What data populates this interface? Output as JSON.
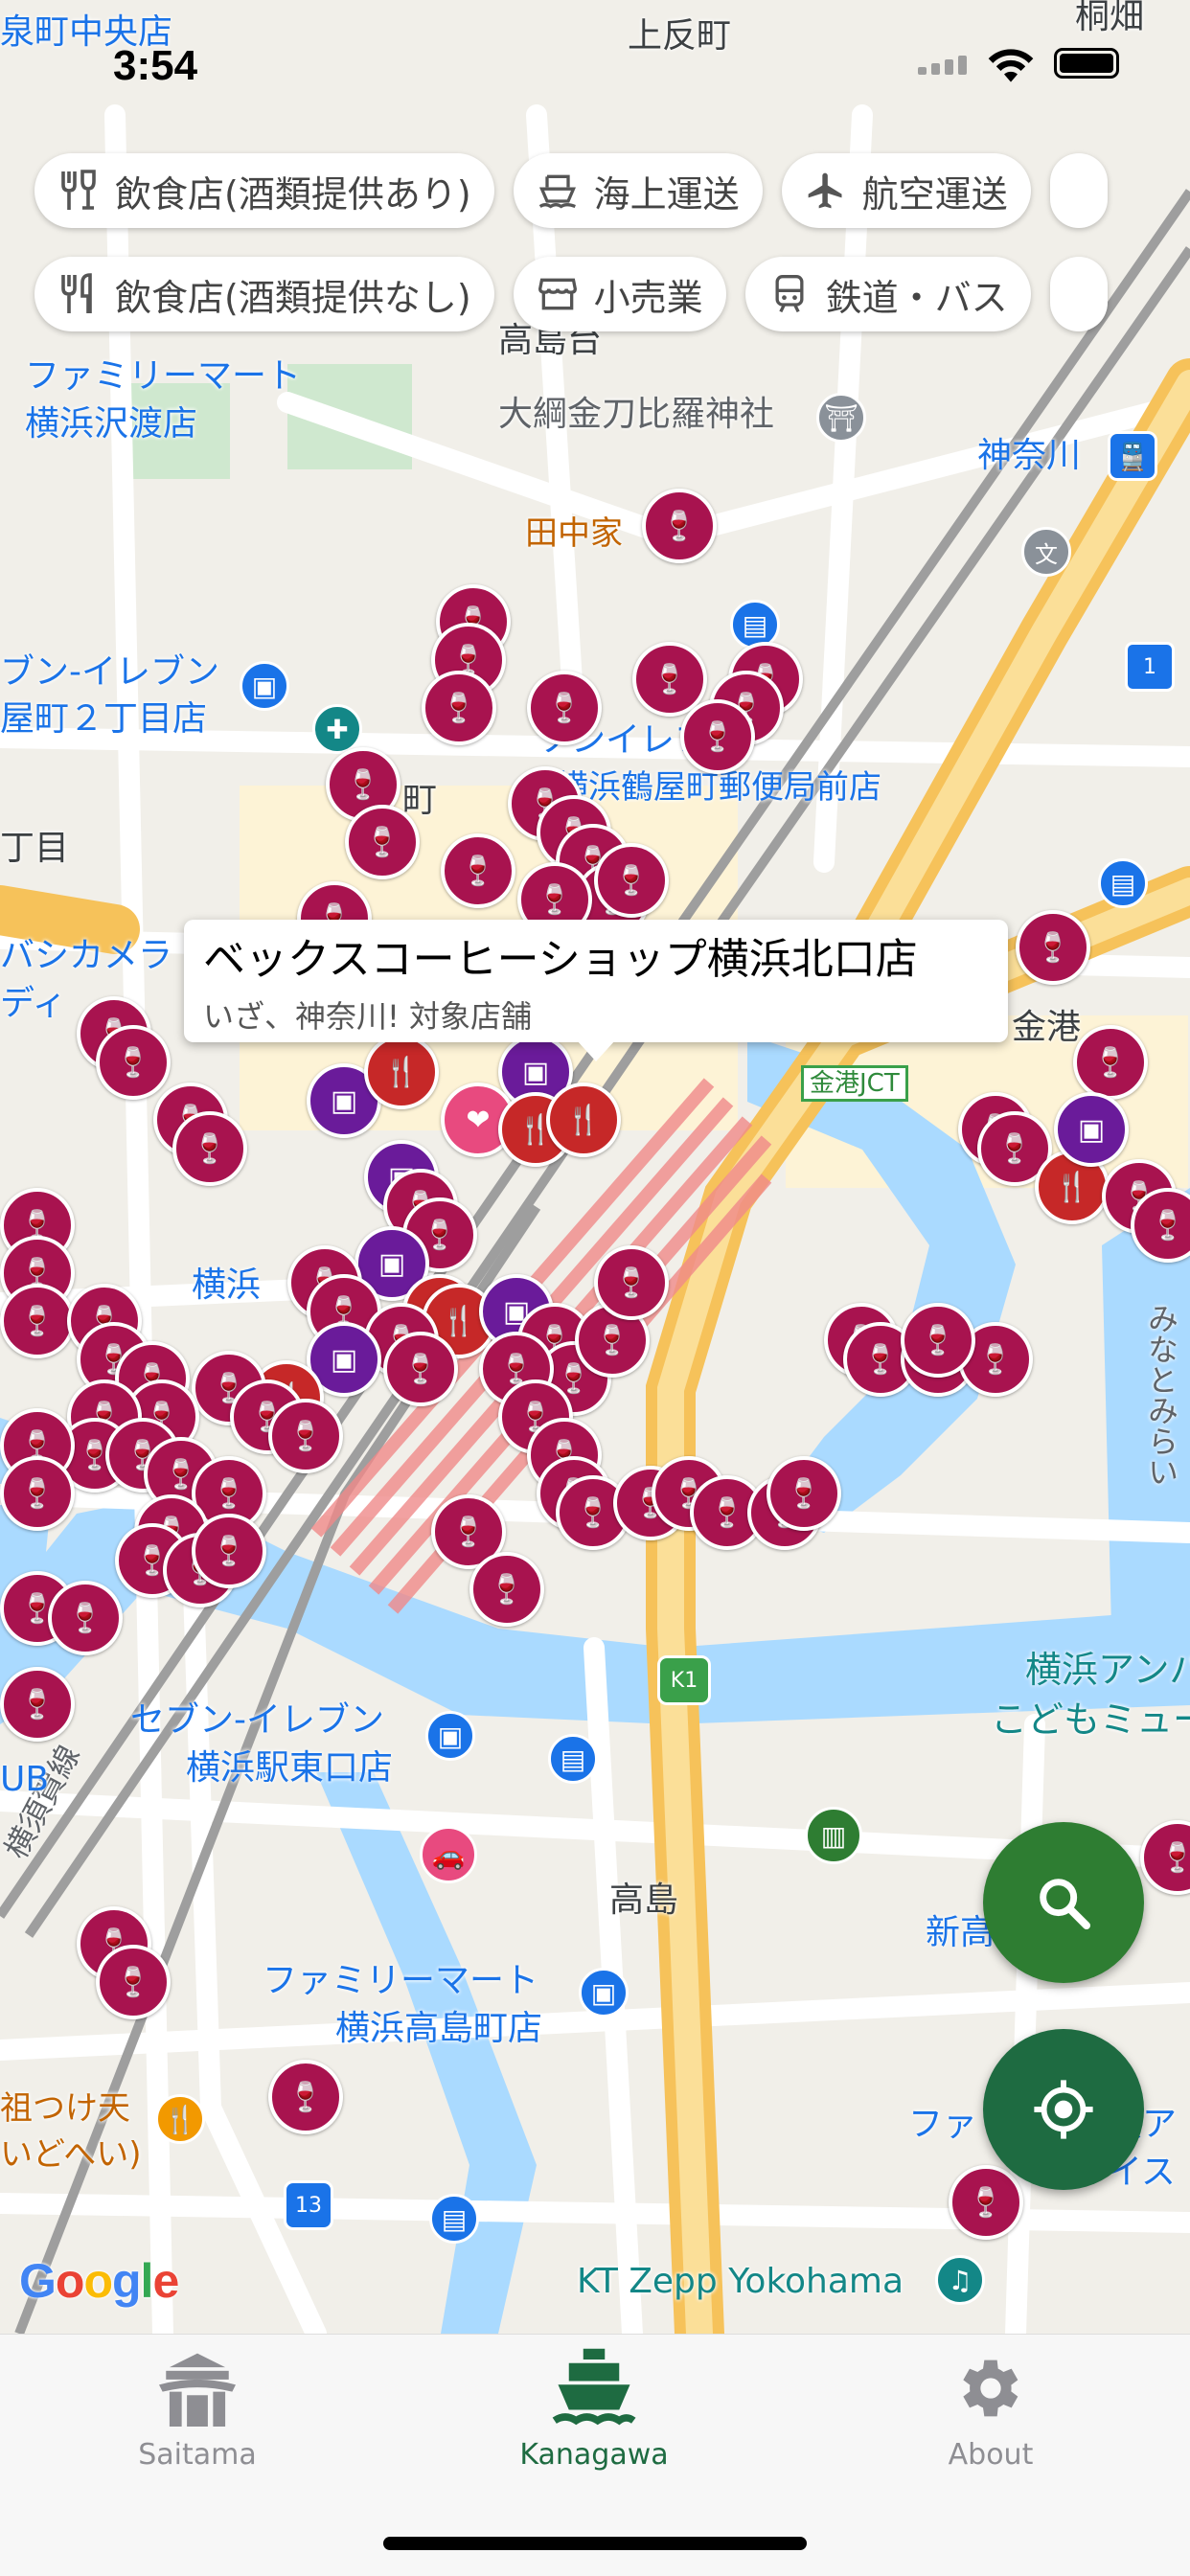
{
  "status_bar": {
    "time": "3:54"
  },
  "filters": {
    "row1": [
      {
        "label": "飲食店(酒類提供あり)",
        "icon": "wine-fork-icon"
      },
      {
        "label": "海上運送",
        "icon": "ship-icon"
      },
      {
        "label": "航空運送",
        "icon": "airplane-icon"
      }
    ],
    "row2": [
      {
        "label": "飲食店(酒類提供なし)",
        "icon": "fork-knife-icon"
      },
      {
        "label": "小売業",
        "icon": "store-icon"
      },
      {
        "label": "鉄道・バス",
        "icon": "train-icon"
      }
    ]
  },
  "map": {
    "labels": {
      "izumicho": "泉町中央店",
      "kamitanmachi": "上反町",
      "kiribata": "桐畑",
      "takashimadai": "高島台",
      "famima_sawatari": "ファミリーマート",
      "famima_sawatari2": "横浜沢渡店",
      "okitsuna": "大綱金刀比羅神社",
      "kanagawa_st": "神奈川",
      "tanakaya": "田中家",
      "seven_mikamachi1": "ブン-イレブン",
      "seven_mikamachi2": "屋町２丁目店",
      "seven_top": "ソンイレブン",
      "post": "横浜鶴屋町郵便局前店",
      "machi": "町",
      "chome": "丁目",
      "bic1": "バシカメラ",
      "bic2": "ディ",
      "kinko": "金港",
      "kinko_jct": "金港JCT",
      "yokohama": "横浜",
      "minatomirai": "みなとみらい",
      "anpanman1": "横浜アンパ",
      "anpanman2": "こどもミュー",
      "seven_east1": "セブン-イレブン",
      "seven_east2": "横浜駅東口店",
      "takashima": "高島",
      "shintakashima": "新高",
      "famima_takashima1": "ファミリーマート",
      "famima_takashima2": "横浜高島町店",
      "sotetsu1": "祖つけ天",
      "sotetsu2": "いどへい)",
      "zepp": "KT Zepp Yokohama",
      "fami_right1": "ファ",
      "fami_right2": "横浜ア",
      "fami_right3": "レイス",
      "yokosuka_line": "横須賀線",
      "ub": "UB",
      "k1": "K1",
      "route13": "13",
      "route1": "1",
      "bunkyo": "文"
    },
    "callout": {
      "title": "ベックスコーヒーショップ横浜北口店",
      "subtitle": "いざ、神奈川! 対象店舗"
    },
    "attribution": "Google"
  },
  "fab": {
    "search_icon": "search-icon",
    "locate_icon": "my-location-icon"
  },
  "tabs": [
    {
      "label": "Saitama",
      "icon": "gate-icon",
      "active": false
    },
    {
      "label": "Kanagawa",
      "icon": "ship-icon",
      "active": true
    },
    {
      "label": "About",
      "icon": "gear-icon",
      "active": false
    }
  ],
  "colors": {
    "accent_green": "#2e7d32",
    "pin_wine": "#a8134f",
    "pin_red": "#c62828",
    "pin_purple": "#6a1b9a",
    "tab_inactive": "#8e8e93"
  }
}
